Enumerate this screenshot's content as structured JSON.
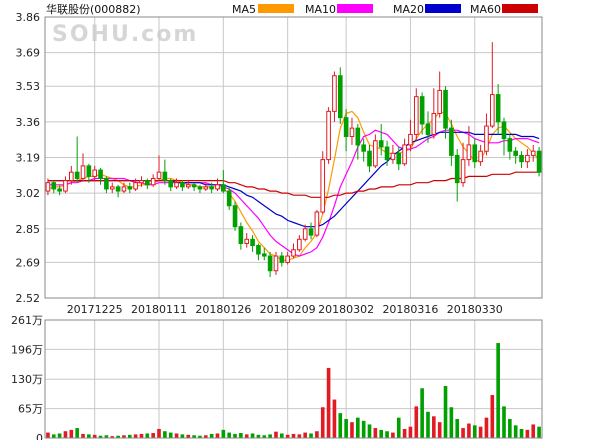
{
  "header": {
    "title": "华联股份(000882)",
    "watermark": "SOHU.com"
  },
  "colors": {
    "up": "#e01b24",
    "down": "#00a000",
    "grid": "#c8c8c8",
    "axis": "#888888"
  },
  "chart_data": {
    "type": "candlestick",
    "price_axis": {
      "ticks": [
        "3.86",
        "3.69",
        "3.53",
        "3.36",
        "3.19",
        "3.02",
        "2.85",
        "2.69",
        "2.52"
      ],
      "ylim": [
        2.52,
        3.86
      ]
    },
    "volume_axis": {
      "ticks": [
        "261万",
        "196万",
        "130万",
        "65万",
        "0"
      ],
      "ylim": [
        0,
        261
      ]
    },
    "x_ticks": [
      "20171225",
      "20180111",
      "20180126",
      "20180209",
      "20180302",
      "20180316",
      "20180330"
    ],
    "x_tick_index": [
      8,
      19,
      30,
      41,
      51,
      62,
      73
    ],
    "legend": [
      {
        "name": "MA5",
        "color": "#ff9900"
      },
      {
        "name": "MA10",
        "color": "#ff00ff"
      },
      {
        "name": "MA20",
        "color": "#0000cc"
      },
      {
        "name": "MA60",
        "color": "#cc0000"
      }
    ],
    "candles": [
      [
        3.03,
        3.07,
        3.09,
        3.01
      ],
      [
        3.07,
        3.04,
        3.08,
        3.02
      ],
      [
        3.04,
        3.03,
        3.06,
        3.01
      ],
      [
        3.03,
        3.08,
        3.1,
        3.02
      ],
      [
        3.08,
        3.12,
        3.15,
        3.06
      ],
      [
        3.12,
        3.09,
        3.29,
        3.07
      ],
      [
        3.09,
        3.15,
        3.21,
        3.08
      ],
      [
        3.15,
        3.1,
        3.16,
        3.07
      ],
      [
        3.1,
        3.13,
        3.15,
        3.08
      ],
      [
        3.13,
        3.09,
        3.14,
        3.06
      ],
      [
        3.09,
        3.04,
        3.1,
        3.02
      ],
      [
        3.04,
        3.05,
        3.07,
        3.02
      ],
      [
        3.05,
        3.03,
        3.06,
        3.0
      ],
      [
        3.03,
        3.05,
        3.07,
        3.02
      ],
      [
        3.05,
        3.04,
        3.07,
        3.02
      ],
      [
        3.04,
        3.07,
        3.09,
        3.03
      ],
      [
        3.07,
        3.08,
        3.1,
        3.05
      ],
      [
        3.08,
        3.06,
        3.09,
        3.04
      ],
      [
        3.06,
        3.09,
        3.11,
        3.05
      ],
      [
        3.09,
        3.12,
        3.2,
        3.08
      ],
      [
        3.12,
        3.08,
        3.18,
        3.06
      ],
      [
        3.08,
        3.05,
        3.09,
        3.03
      ],
      [
        3.05,
        3.07,
        3.09,
        3.04
      ],
      [
        3.07,
        3.05,
        3.08,
        3.03
      ],
      [
        3.05,
        3.06,
        3.08,
        3.04
      ],
      [
        3.06,
        3.05,
        3.07,
        3.03
      ],
      [
        3.05,
        3.04,
        3.06,
        3.02
      ],
      [
        3.04,
        3.05,
        3.07,
        3.03
      ],
      [
        3.05,
        3.04,
        3.07,
        3.02
      ],
      [
        3.04,
        3.06,
        3.09,
        3.03
      ],
      [
        3.06,
        3.03,
        3.13,
        3.02
      ],
      [
        3.03,
        2.96,
        3.05,
        2.94
      ],
      [
        2.96,
        2.86,
        2.98,
        2.84
      ],
      [
        2.86,
        2.78,
        2.88,
        2.75
      ],
      [
        2.78,
        2.8,
        2.83,
        2.76
      ],
      [
        2.8,
        2.77,
        2.82,
        2.74
      ],
      [
        2.77,
        2.73,
        2.78,
        2.7
      ],
      [
        2.73,
        2.72,
        2.76,
        2.7
      ],
      [
        2.72,
        2.65,
        2.74,
        2.62
      ],
      [
        2.65,
        2.72,
        2.74,
        2.63
      ],
      [
        2.72,
        2.69,
        2.74,
        2.67
      ],
      [
        2.69,
        2.72,
        2.74,
        2.68
      ],
      [
        2.72,
        2.75,
        2.78,
        2.71
      ],
      [
        2.75,
        2.8,
        2.82,
        2.74
      ],
      [
        2.8,
        2.85,
        2.87,
        2.79
      ],
      [
        2.85,
        2.82,
        2.88,
        2.8
      ],
      [
        2.82,
        2.93,
        2.94,
        2.81
      ],
      [
        2.93,
        3.18,
        3.22,
        2.92
      ],
      [
        3.18,
        3.41,
        3.43,
        3.16
      ],
      [
        3.41,
        3.58,
        3.6,
        3.36
      ],
      [
        3.58,
        3.38,
        3.62,
        3.35
      ],
      [
        3.38,
        3.29,
        3.42,
        3.22
      ],
      [
        3.29,
        3.33,
        3.38,
        3.25
      ],
      [
        3.33,
        3.25,
        3.35,
        3.18
      ],
      [
        3.25,
        3.22,
        3.28,
        3.17
      ],
      [
        3.22,
        3.15,
        3.25,
        3.12
      ],
      [
        3.15,
        3.27,
        3.3,
        3.14
      ],
      [
        3.27,
        3.24,
        3.35,
        3.2
      ],
      [
        3.24,
        3.18,
        3.27,
        3.15
      ],
      [
        3.18,
        3.21,
        3.25,
        3.16
      ],
      [
        3.21,
        3.16,
        3.24,
        3.13
      ],
      [
        3.16,
        3.25,
        3.28,
        3.15
      ],
      [
        3.25,
        3.3,
        3.37,
        3.22
      ],
      [
        3.3,
        3.48,
        3.52,
        3.27
      ],
      [
        3.48,
        3.35,
        3.5,
        3.3
      ],
      [
        3.35,
        3.3,
        3.41,
        3.26
      ],
      [
        3.3,
        3.4,
        3.52,
        3.28
      ],
      [
        3.4,
        3.51,
        3.6,
        3.38
      ],
      [
        3.51,
        3.33,
        3.53,
        3.28
      ],
      [
        3.33,
        3.2,
        3.37,
        3.15
      ],
      [
        3.2,
        3.07,
        3.23,
        2.98
      ],
      [
        3.07,
        3.18,
        3.26,
        3.05
      ],
      [
        3.18,
        3.25,
        3.34,
        3.15
      ],
      [
        3.25,
        3.17,
        3.28,
        3.14
      ],
      [
        3.17,
        3.22,
        3.25,
        3.15
      ],
      [
        3.22,
        3.34,
        3.4,
        3.2
      ],
      [
        3.34,
        3.49,
        3.74,
        3.33
      ],
      [
        3.49,
        3.36,
        3.54,
        3.3
      ],
      [
        3.36,
        3.28,
        3.38,
        3.2
      ],
      [
        3.28,
        3.22,
        3.3,
        3.18
      ],
      [
        3.22,
        3.2,
        3.24,
        3.16
      ],
      [
        3.2,
        3.17,
        3.22,
        3.14
      ],
      [
        3.17,
        3.2,
        3.23,
        3.14
      ],
      [
        3.2,
        3.22,
        3.25,
        3.17
      ],
      [
        3.22,
        3.12,
        3.24,
        3.1
      ]
    ],
    "volumes": [
      12,
      8,
      10,
      15,
      18,
      22,
      9,
      8,
      7,
      5,
      6,
      4,
      5,
      6,
      7,
      8,
      9,
      10,
      11,
      20,
      15,
      12,
      10,
      8,
      7,
      6,
      5,
      6,
      9,
      10,
      18,
      12,
      9,
      11,
      8,
      10,
      7,
      6,
      8,
      14,
      10,
      7,
      9,
      8,
      12,
      10,
      15,
      68,
      155,
      85,
      55,
      42,
      35,
      45,
      38,
      30,
      22,
      18,
      15,
      12,
      45,
      20,
      25,
      70,
      110,
      58,
      48,
      35,
      115,
      68,
      42,
      22,
      32,
      28,
      25,
      45,
      95,
      210,
      70,
      42,
      28,
      20,
      18,
      30,
      25
    ],
    "ma5": [
      3.04,
      3.05,
      3.05,
      3.06,
      3.07,
      3.08,
      3.09,
      3.1,
      3.1,
      3.11,
      3.1,
      3.09,
      3.08,
      3.06,
      3.05,
      3.05,
      3.06,
      3.06,
      3.07,
      3.08,
      3.09,
      3.09,
      3.08,
      3.07,
      3.06,
      3.06,
      3.05,
      3.05,
      3.05,
      3.05,
      3.04,
      3.02,
      2.98,
      2.93,
      2.88,
      2.84,
      2.79,
      2.76,
      2.73,
      2.72,
      2.7,
      2.7,
      2.71,
      2.72,
      2.76,
      2.79,
      2.83,
      2.92,
      3.04,
      3.18,
      3.33,
      3.4,
      3.41,
      3.38,
      3.31,
      3.25,
      3.24,
      3.23,
      3.21,
      3.21,
      3.21,
      3.22,
      3.23,
      3.28,
      3.32,
      3.35,
      3.37,
      3.41,
      3.4,
      3.35,
      3.29,
      3.24,
      3.21,
      3.17,
      3.18,
      3.23,
      3.3,
      3.33,
      3.34,
      3.31,
      3.28,
      3.26,
      3.24,
      3.21,
      3.18
    ],
    "ma10": [
      3.06,
      3.06,
      3.06,
      3.06,
      3.07,
      3.07,
      3.08,
      3.08,
      3.09,
      3.09,
      3.09,
      3.09,
      3.09,
      3.09,
      3.08,
      3.07,
      3.07,
      3.06,
      3.06,
      3.07,
      3.07,
      3.07,
      3.07,
      3.07,
      3.07,
      3.07,
      3.07,
      3.07,
      3.06,
      3.06,
      3.05,
      3.04,
      3.02,
      2.99,
      2.96,
      2.93,
      2.9,
      2.86,
      2.82,
      2.79,
      2.77,
      2.75,
      2.73,
      2.72,
      2.73,
      2.74,
      2.76,
      2.81,
      2.88,
      2.96,
      3.05,
      3.11,
      3.17,
      3.24,
      3.29,
      3.3,
      3.32,
      3.31,
      3.3,
      3.27,
      3.24,
      3.23,
      3.23,
      3.24,
      3.26,
      3.28,
      3.29,
      3.31,
      3.32,
      3.32,
      3.32,
      3.31,
      3.3,
      3.28,
      3.27,
      3.26,
      3.26,
      3.26,
      3.27,
      3.27,
      3.28,
      3.28,
      3.28,
      3.27,
      3.26
    ],
    "ma20": [
      3.08,
      3.08,
      3.08,
      3.08,
      3.08,
      3.08,
      3.08,
      3.08,
      3.08,
      3.08,
      3.08,
      3.08,
      3.08,
      3.08,
      3.08,
      3.08,
      3.08,
      3.08,
      3.08,
      3.08,
      3.08,
      3.08,
      3.07,
      3.07,
      3.07,
      3.07,
      3.07,
      3.06,
      3.06,
      3.06,
      3.06,
      3.05,
      3.04,
      3.03,
      3.01,
      3.0,
      2.98,
      2.96,
      2.94,
      2.92,
      2.91,
      2.89,
      2.88,
      2.87,
      2.86,
      2.86,
      2.86,
      2.87,
      2.89,
      2.91,
      2.94,
      2.97,
      3.0,
      3.03,
      3.06,
      3.09,
      3.12,
      3.15,
      3.17,
      3.2,
      3.22,
      3.24,
      3.26,
      3.27,
      3.28,
      3.29,
      3.3,
      3.31,
      3.31,
      3.31,
      3.31,
      3.31,
      3.31,
      3.3,
      3.3,
      3.3,
      3.3,
      3.3,
      3.3,
      3.3,
      3.3,
      3.29,
      3.29,
      3.29,
      3.28
    ],
    "ma60": [
      3.08,
      3.08,
      3.08,
      3.08,
      3.08,
      3.08,
      3.08,
      3.08,
      3.08,
      3.08,
      3.08,
      3.08,
      3.08,
      3.08,
      3.08,
      3.08,
      3.08,
      3.08,
      3.08,
      3.08,
      3.08,
      3.08,
      3.08,
      3.08,
      3.08,
      3.08,
      3.08,
      3.08,
      3.08,
      3.08,
      3.08,
      3.07,
      3.07,
      3.06,
      3.05,
      3.05,
      3.04,
      3.04,
      3.03,
      3.03,
      3.02,
      3.02,
      3.01,
      3.01,
      3.01,
      3.0,
      3.0,
      3.0,
      3.0,
      3.01,
      3.01,
      3.02,
      3.02,
      3.03,
      3.03,
      3.04,
      3.04,
      3.05,
      3.05,
      3.05,
      3.06,
      3.06,
      3.06,
      3.07,
      3.07,
      3.07,
      3.08,
      3.08,
      3.08,
      3.09,
      3.09,
      3.09,
      3.1,
      3.1,
      3.1,
      3.1,
      3.11,
      3.11,
      3.11,
      3.11,
      3.12,
      3.12,
      3.12,
      3.12,
      3.12
    ]
  }
}
